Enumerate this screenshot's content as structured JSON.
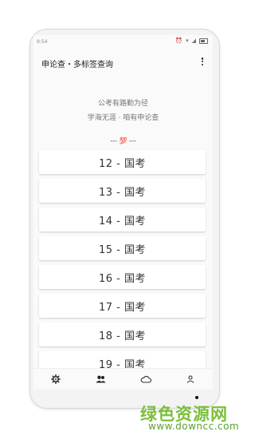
{
  "status_bar": {
    "time": "9:54"
  },
  "app_bar": {
    "title": "申论查・多标签查询"
  },
  "motto": {
    "line1": "公考有路勤为径",
    "line2": "学海无涯 · 咱有申论查"
  },
  "divider_text": "--- 💯 ---",
  "list_items": [
    {
      "label": "12 - 国考"
    },
    {
      "label": "13 - 国考"
    },
    {
      "label": "14 - 国考"
    },
    {
      "label": "15 - 国考"
    },
    {
      "label": "16 - 国考"
    },
    {
      "label": "17 - 国考"
    },
    {
      "label": "18 - 国考"
    },
    {
      "label": "19 - 国考"
    }
  ],
  "bottom_nav": [
    {
      "icon": "gear-icon"
    },
    {
      "icon": "people-icon"
    },
    {
      "icon": "cloud-icon"
    },
    {
      "icon": "person-icon"
    }
  ],
  "watermark": {
    "text": "绿色资源网",
    "url": "www.downcc.com"
  },
  "colors": {
    "watermark": "#7bbf3a",
    "accent": "#222222"
  }
}
